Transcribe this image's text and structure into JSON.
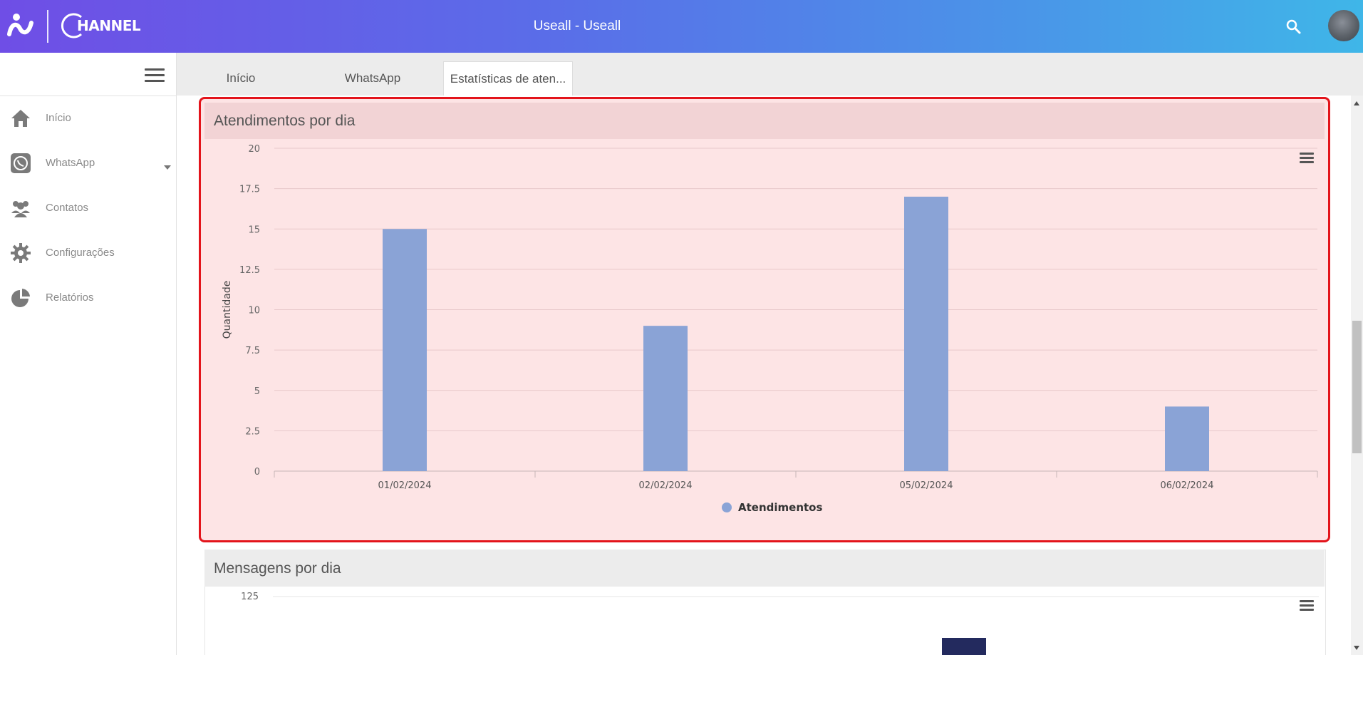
{
  "header": {
    "title": "Useall - Useall",
    "logo_text": "HANNEL",
    "search_icon": "search-icon",
    "accent_gradient": [
      "#6f4ee6",
      "#3fb6e8"
    ]
  },
  "sidebar": {
    "items": [
      {
        "label": "Início",
        "icon": "home-icon"
      },
      {
        "label": "WhatsApp",
        "icon": "whatsapp-icon"
      },
      {
        "label": "Contatos",
        "icon": "contacts-icon"
      },
      {
        "label": "Configurações",
        "icon": "gear-icon"
      },
      {
        "label": "Relatórios",
        "icon": "pie-chart-icon"
      }
    ]
  },
  "tabs": [
    {
      "label": "Início"
    },
    {
      "label": "WhatsApp"
    },
    {
      "label": "Estatísticas de aten..."
    }
  ],
  "cards": {
    "attendances_title": "Atendimentos por dia",
    "messages_title": "Mensagens por dia",
    "messages_first_tick": "125",
    "highlight_color": "#e3141b"
  },
  "chart_data": [
    {
      "type": "bar",
      "title": "Atendimentos por dia",
      "categories": [
        "01/02/2024",
        "02/02/2024",
        "05/02/2024",
        "06/02/2024"
      ],
      "series": [
        {
          "name": "Atendimentos",
          "values": [
            15,
            9,
            17,
            4
          ],
          "color": "#8aa3d6"
        }
      ],
      "ylabel": "Quantidade",
      "xlabel": "",
      "ylim": [
        0,
        20
      ],
      "yticks": [
        "0",
        "2.5",
        "5",
        "7.5",
        "10",
        "12.5",
        "15",
        "17.5",
        "20"
      ],
      "grid": true,
      "legend": "bottom-center"
    },
    {
      "type": "bar",
      "title": "Mensagens por dia",
      "yticks": [
        "125"
      ],
      "partial": true
    }
  ]
}
